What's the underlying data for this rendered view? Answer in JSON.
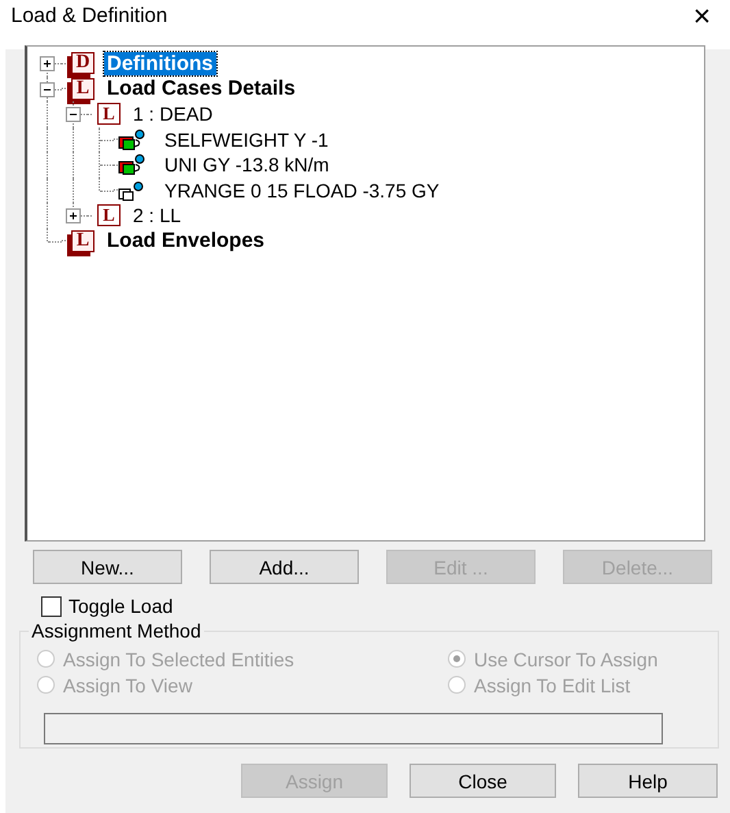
{
  "window": {
    "title": "Load & Definition",
    "close": "×"
  },
  "tree": [
    {
      "badge": "D",
      "label": "Definitions",
      "kind": "group",
      "expanded": false,
      "selected": true
    },
    {
      "badge": "L",
      "label": "Load Cases Details",
      "kind": "group",
      "expanded": true,
      "selected": false,
      "children": [
        {
          "badge": "L",
          "label": "1 : DEAD",
          "kind": "case",
          "expanded": true,
          "selected": false,
          "children": [
            {
              "label": "SELFWEIGHT Y -1",
              "kind": "load",
              "selected": false
            },
            {
              "label": "UNI GY -13.8 kN/m",
              "kind": "load",
              "selected": false
            },
            {
              "label": "YRANGE 0 15 FLOAD -3.75 GY",
              "kind": "range",
              "selected": false
            }
          ]
        },
        {
          "badge": "L",
          "label": "2 : LL",
          "kind": "case",
          "expanded": false,
          "selected": false
        }
      ]
    },
    {
      "badge": "L",
      "label": "Load Envelopes",
      "kind": "group",
      "selected": false
    }
  ],
  "buttons": [
    {
      "label": "New...",
      "disabled": false
    },
    {
      "label": "Add...",
      "disabled": false
    },
    {
      "label": "Edit ...",
      "disabled": true
    },
    {
      "label": "Delete...",
      "disabled": true
    }
  ],
  "toggle_load": {
    "label": "Toggle Load",
    "checked": false
  },
  "assignment_method": {
    "title": "Assignment Method",
    "disabled": true,
    "options": [
      {
        "label": "Assign To Selected Entities",
        "selected": false
      },
      {
        "label": "Use Cursor To Assign",
        "selected": true
      },
      {
        "label": "Assign To View",
        "selected": false
      },
      {
        "label": "Assign To Edit List",
        "selected": false
      }
    ]
  },
  "footer_buttons": [
    {
      "label": "Assign",
      "disabled": true
    },
    {
      "label": "Close",
      "disabled": false
    },
    {
      "label": "Help",
      "disabled": false
    }
  ]
}
